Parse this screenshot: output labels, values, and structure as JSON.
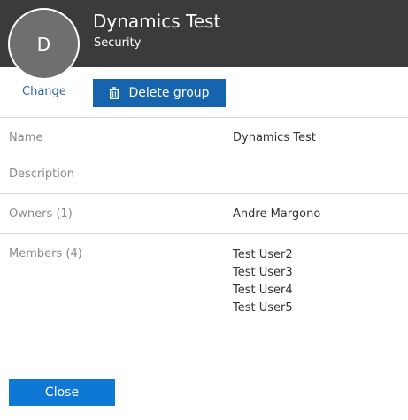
{
  "header": {
    "avatar_initial": "D",
    "title": "Dynamics Test",
    "subtitle": "Security",
    "background": "#3b3b3b"
  },
  "actions": {
    "change_label": "Change",
    "delete_label": "Delete group",
    "delete_icon": "trash-icon",
    "accent": "#1664ad"
  },
  "details": {
    "name_label": "Name",
    "name_value": "Dynamics Test",
    "description_label": "Description",
    "description_value": "",
    "owners_label": "Owners (1)",
    "owners": [
      "Andre Margono"
    ],
    "members_label": "Members (4)",
    "members": [
      "Test User2",
      "Test User3",
      "Test User4",
      "Test User5"
    ]
  },
  "footer": {
    "close_label": "Close"
  }
}
